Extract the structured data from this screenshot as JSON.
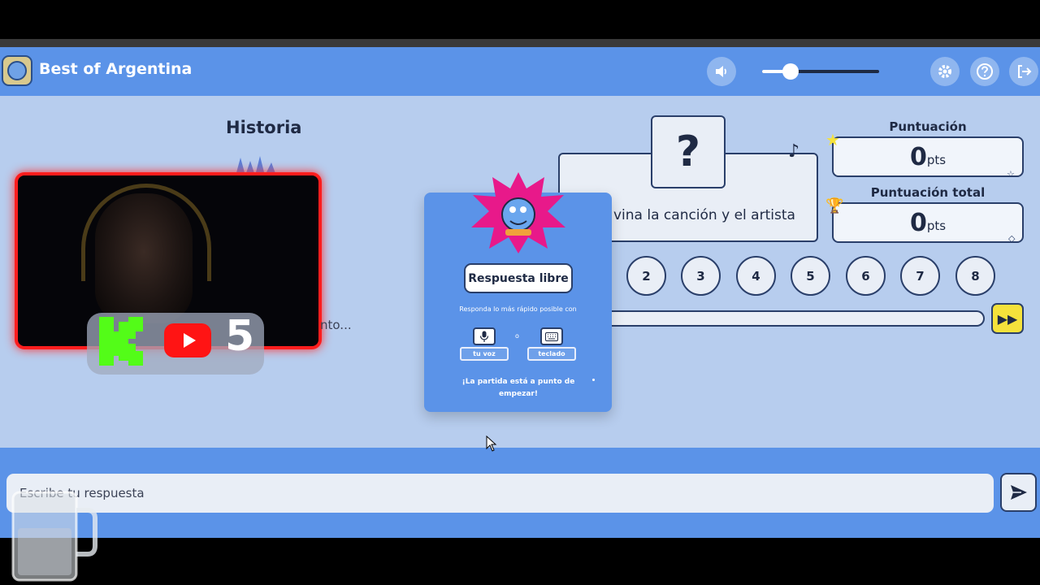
{
  "header": {
    "title": "Best of Argentina",
    "volume_level": 0.24,
    "icons": [
      "speaker-icon",
      "gear-icon",
      "help-icon",
      "exit-icon"
    ]
  },
  "category": {
    "label": "Historia"
  },
  "stream_badge": {
    "count": "5"
  },
  "background_text": "nto...",
  "modal": {
    "button_label": "Respuesta libre",
    "instruction": "Responda lo más rápido posible con",
    "option_voice": "tu voz",
    "option_separator": "o",
    "option_keyboard": "teclado",
    "start_message": "¡La partida está a punto de empezar!"
  },
  "question": {
    "mark": "?",
    "text": "vina la canción y el artista"
  },
  "scores": {
    "current_title": "Puntuación",
    "current_value": "0",
    "current_unit": "pts",
    "total_title": "Puntuación total",
    "total_value": "0",
    "total_unit": "pts"
  },
  "rounds": [
    "2",
    "3",
    "4",
    "5",
    "6",
    "7",
    "8"
  ],
  "answer": {
    "placeholder": "Escribe tu respuesta"
  },
  "colors": {
    "accent": "#5b93e8",
    "background": "#b7cdee",
    "highlight": "#f5e23b",
    "webcam_border": "#ff1d1d"
  }
}
